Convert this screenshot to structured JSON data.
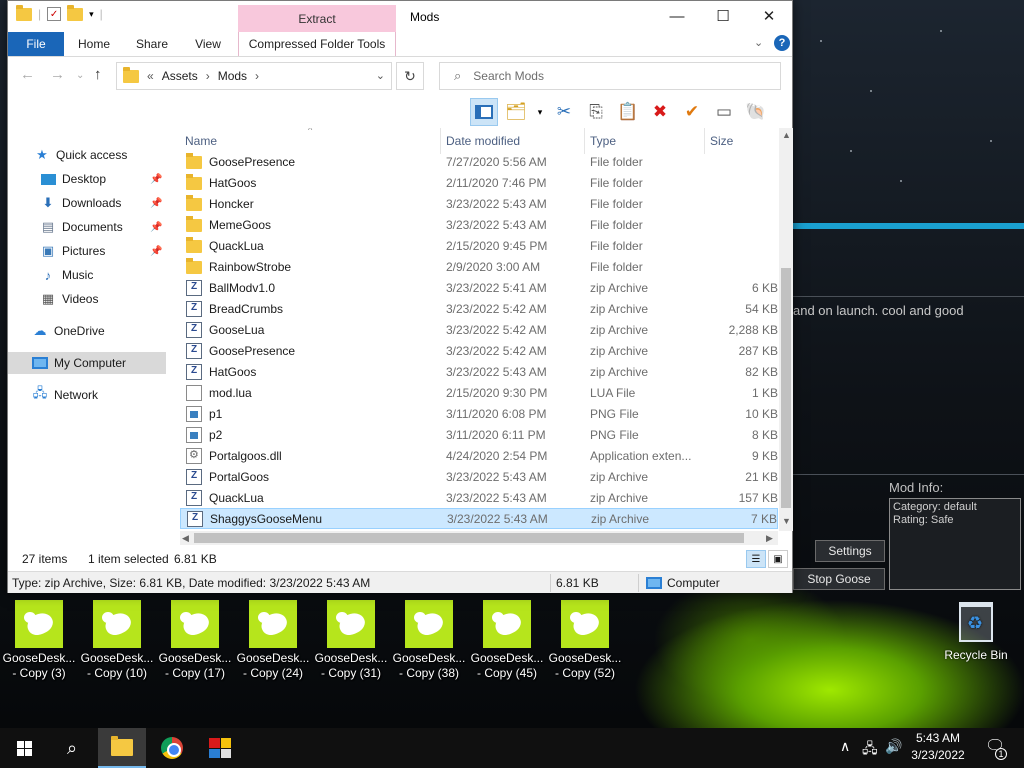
{
  "window": {
    "title": "Mods",
    "contextual_tab": "Extract",
    "minimize_glyph": "—",
    "maximize_glyph": "☐",
    "close_glyph": "✕"
  },
  "ribbon": {
    "tabs": [
      "File",
      "Home",
      "Share",
      "View",
      "Compressed Folder Tools"
    ],
    "expand_glyph": "⌄",
    "help_glyph": "?"
  },
  "address": {
    "chevron": "«",
    "crumbs": [
      "Assets",
      "Mods"
    ],
    "separator": "›"
  },
  "search": {
    "placeholder": "Search Mods"
  },
  "navpane": {
    "items": [
      {
        "label": "Quick access",
        "icon": "star-icon"
      },
      {
        "label": "Desktop",
        "icon": "desktop-icon"
      },
      {
        "label": "Downloads",
        "icon": "download-icon"
      },
      {
        "label": "Documents",
        "icon": "documents-icon"
      },
      {
        "label": "Pictures",
        "icon": "pictures-icon"
      },
      {
        "label": "Music",
        "icon": "music-icon"
      },
      {
        "label": "Videos",
        "icon": "videos-icon"
      },
      {
        "label": "OneDrive",
        "icon": "cloud-icon"
      },
      {
        "label": "My Computer",
        "icon": "computer-icon"
      },
      {
        "label": "Network",
        "icon": "network-icon"
      }
    ]
  },
  "columns": {
    "name": "Name",
    "date": "Date modified",
    "type": "Type",
    "size": "Size"
  },
  "files": [
    {
      "name": "GoosePresence",
      "date": "7/27/2020 5:56 AM",
      "type": "File folder",
      "size": "",
      "kind": "folder"
    },
    {
      "name": "HatGoos",
      "date": "2/11/2020 7:46 PM",
      "type": "File folder",
      "size": "",
      "kind": "folder"
    },
    {
      "name": "Honcker",
      "date": "3/23/2022 5:43 AM",
      "type": "File folder",
      "size": "",
      "kind": "folder"
    },
    {
      "name": "MemeGoos",
      "date": "3/23/2022 5:43 AM",
      "type": "File folder",
      "size": "",
      "kind": "folder"
    },
    {
      "name": "QuackLua",
      "date": "2/15/2020 9:45 PM",
      "type": "File folder",
      "size": "",
      "kind": "folder"
    },
    {
      "name": "RainbowStrobe",
      "date": "2/9/2020 3:00 AM",
      "type": "File folder",
      "size": "",
      "kind": "folder"
    },
    {
      "name": "BallModv1.0",
      "date": "3/23/2022 5:41 AM",
      "type": "zip Archive",
      "size": "6 KB",
      "kind": "zip"
    },
    {
      "name": "BreadCrumbs",
      "date": "3/23/2022 5:42 AM",
      "type": "zip Archive",
      "size": "54 KB",
      "kind": "zip"
    },
    {
      "name": "GooseLua",
      "date": "3/23/2022 5:42 AM",
      "type": "zip Archive",
      "size": "2,288 KB",
      "kind": "zip"
    },
    {
      "name": "GoosePresence",
      "date": "3/23/2022 5:42 AM",
      "type": "zip Archive",
      "size": "287 KB",
      "kind": "zip"
    },
    {
      "name": "HatGoos",
      "date": "3/23/2022 5:43 AM",
      "type": "zip Archive",
      "size": "82 KB",
      "kind": "zip"
    },
    {
      "name": "mod.lua",
      "date": "2/15/2020 9:30 PM",
      "type": "LUA File",
      "size": "1 KB",
      "kind": "doc"
    },
    {
      "name": "p1",
      "date": "3/11/2020 6:08 PM",
      "type": "PNG File",
      "size": "10 KB",
      "kind": "png"
    },
    {
      "name": "p2",
      "date": "3/11/2020 6:11 PM",
      "type": "PNG File",
      "size": "8 KB",
      "kind": "png"
    },
    {
      "name": "Portalgoos.dll",
      "date": "4/24/2020 2:54 PM",
      "type": "Application exten...",
      "size": "9 KB",
      "kind": "dll"
    },
    {
      "name": "PortalGoos",
      "date": "3/23/2022 5:43 AM",
      "type": "zip Archive",
      "size": "21 KB",
      "kind": "zip"
    },
    {
      "name": "QuackLua",
      "date": "3/23/2022 5:43 AM",
      "type": "zip Archive",
      "size": "157 KB",
      "kind": "zip"
    },
    {
      "name": "ShaggysGooseMenu",
      "date": "3/23/2022 5:43 AM",
      "type": "zip Archive",
      "size": "7 KB",
      "kind": "zip",
      "selected": true
    }
  ],
  "status": {
    "count": "27 items",
    "selected": "1 item selected",
    "sel_size": "6.81 KB"
  },
  "details": {
    "info": "Type: zip Archive, Size: 6.81 KB, Date modified: 3/23/2022 5:43 AM",
    "size": "6.81 KB",
    "location": "Computer"
  },
  "goose_app": {
    "description": "and on launch. cool and good",
    "mod_info_title": "Mod Info:",
    "category": "Category: default",
    "rating": "Rating: Safe",
    "settings_button": "Settings",
    "stop_button": "Stop Goose"
  },
  "desktop_icons": [
    {
      "line1": "GooseDesk...",
      "line2": "- Copy (3)"
    },
    {
      "line1": "GooseDesk...",
      "line2": "- Copy (10)"
    },
    {
      "line1": "GooseDesk...",
      "line2": "- Copy (17)"
    },
    {
      "line1": "GooseDesk...",
      "line2": "- Copy (24)"
    },
    {
      "line1": "GooseDesk...",
      "line2": "- Copy (31)"
    },
    {
      "line1": "GooseDesk...",
      "line2": "- Copy (38)"
    },
    {
      "line1": "GooseDesk...",
      "line2": "- Copy (45)"
    },
    {
      "line1": "GooseDesk...",
      "line2": "- Copy (52)"
    }
  ],
  "recycle_bin": "Recycle Bin",
  "taskbar": {
    "time": "5:43 AM",
    "date": "3/23/2022",
    "notification_count": "1"
  },
  "colors": {
    "accent": "#1a66b8",
    "selection": "#cce8ff",
    "extract_tab": "#f8c8dc",
    "goose_thumb": "#b6e51c",
    "app_accent": "#1aa0d0"
  }
}
